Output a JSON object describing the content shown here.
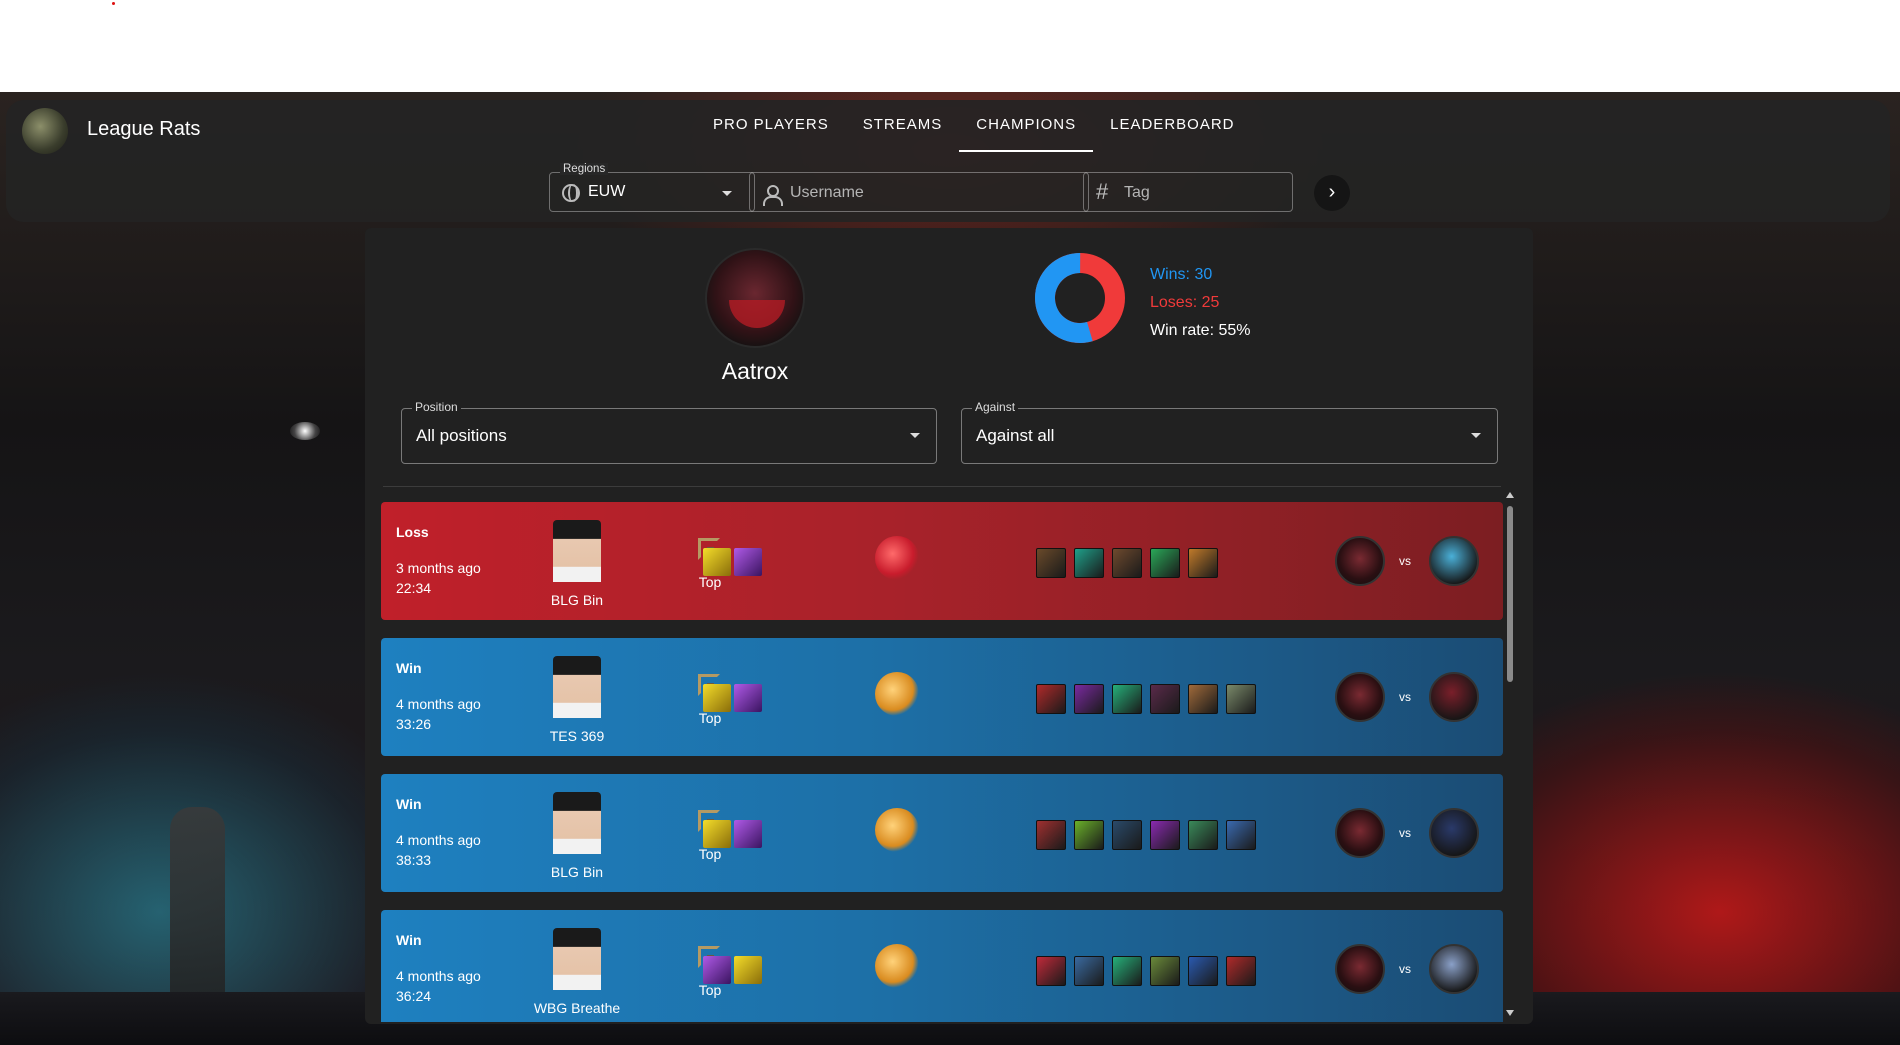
{
  "app": {
    "title": "League Rats"
  },
  "nav": {
    "links": [
      "PRO PLAYERS",
      "STREAMS",
      "CHAMPIONS",
      "LEADERBOARD"
    ],
    "active": "CHAMPIONS"
  },
  "search": {
    "region_label": "Regions",
    "region_value": "EUW",
    "username_placeholder": "Username",
    "tag_placeholder": "Tag"
  },
  "champion": {
    "name": "Aatrox",
    "wins_text": "Wins: 30",
    "loses_text": "Loses: 25",
    "winrate_text": "Win rate: 55%",
    "wins": 30,
    "loses": 25,
    "colors": {
      "wins": "#2196f3",
      "loses": "#f03a3a"
    }
  },
  "filters": {
    "position_label": "Position",
    "position_value": "All positions",
    "against_label": "Against",
    "against_value": "Against all"
  },
  "matches": [
    {
      "result": "Loss",
      "ago": "3 months ago",
      "duration": "22:34",
      "player": "BLG Bin",
      "position": "Top",
      "spells": [
        "flash",
        "teleport"
      ],
      "rune": "red",
      "opponent_color": "#4ab0d8",
      "items": [
        "#6a4a2a",
        "#1fa08a",
        "#6e4a2e",
        "#2aa858",
        "#c07a2a"
      ]
    },
    {
      "result": "Win",
      "ago": "4 months ago",
      "duration": "33:26",
      "player": "TES 369",
      "position": "Top",
      "spells": [
        "flash",
        "teleport"
      ],
      "rune": "gold",
      "opponent_color": "#7a1f2a",
      "items": [
        "#b02a2a",
        "#7a2aa0",
        "#26b07a",
        "#5a2a4a",
        "#a06a3a",
        "#7a8a6a"
      ]
    },
    {
      "result": "Win",
      "ago": "4 months ago",
      "duration": "38:33",
      "player": "BLG Bin",
      "position": "Top",
      "spells": [
        "flash",
        "teleport"
      ],
      "rune": "gold",
      "opponent_color": "#2a3a6a",
      "items": [
        "#a03030",
        "#6ab02a",
        "#2a4a6a",
        "#8a2ab0",
        "#3a8a5a",
        "#3a6ab0"
      ]
    },
    {
      "result": "Win",
      "ago": "4 months ago",
      "duration": "36:24",
      "player": "WBG Breathe",
      "position": "Top",
      "spells": [
        "teleport",
        "flash"
      ],
      "rune": "gold",
      "opponent_color": "#8aa0c8",
      "items": [
        "#c02a3a",
        "#3a6aa0",
        "#26b07a",
        "#6a8a3a",
        "#2a5ab0",
        "#b02a2a"
      ]
    }
  ]
}
